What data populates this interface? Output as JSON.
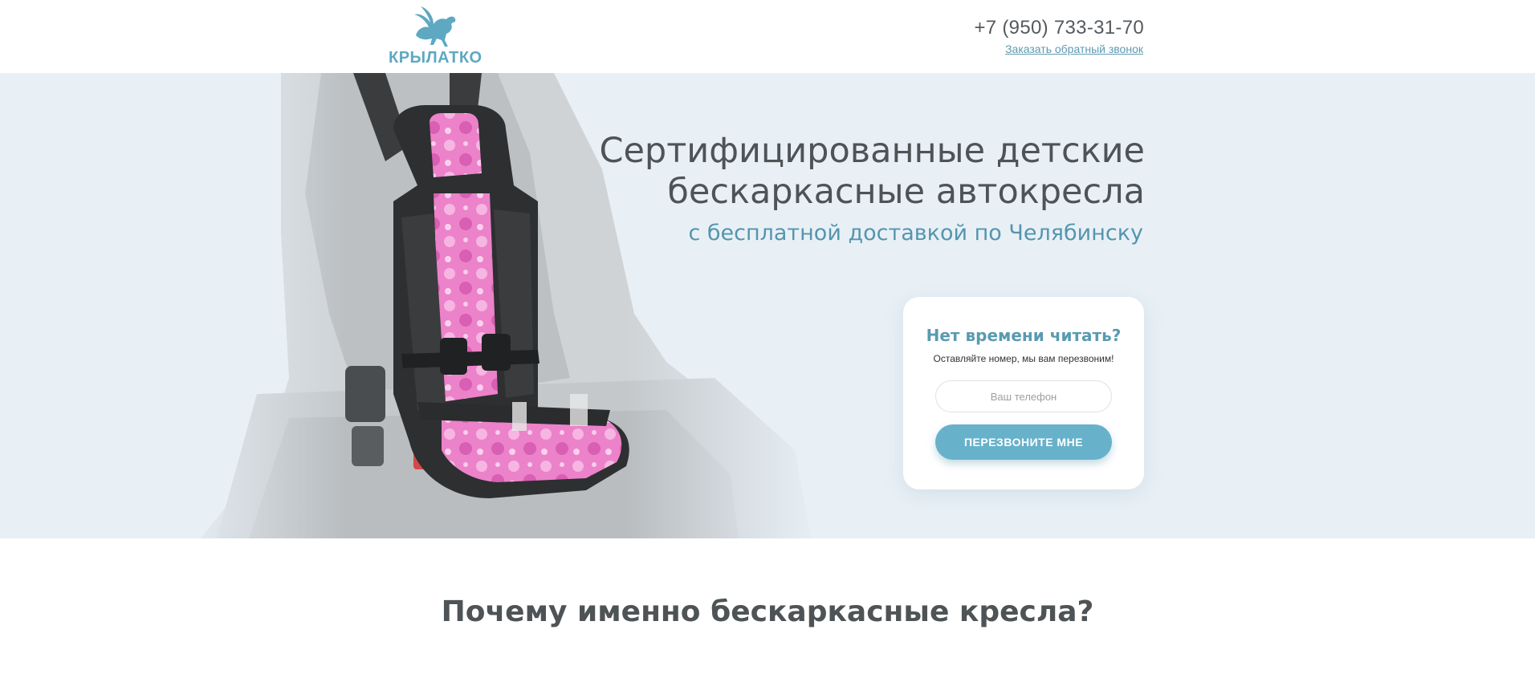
{
  "header": {
    "logo_text": "КРЫЛАТКО",
    "phone": "+7 (950) 733-31-70",
    "callback_link": "Заказать обратный звонок"
  },
  "hero": {
    "title": "Сертифицированные детские бескаркасные автокресла",
    "subtitle": "с бесплатной доставкой по Челябинску",
    "form": {
      "title": "Нет времени читать?",
      "description": "Оставляйте номер, мы вам перезвоним!",
      "phone_placeholder": "Ваш телефон",
      "submit_label": "ПЕРЕЗВОНИТЕ МНЕ"
    }
  },
  "why": {
    "title": "Почему именно бескаркасные кресла?"
  },
  "colors": {
    "accent": "#67b1cb",
    "accent_text": "#5595ad",
    "hero_bg": "#e8f0f6",
    "heading": "#4e5356",
    "seat_pink": "#e97bc6",
    "seat_dark": "#2d2f31"
  },
  "icons": {
    "logo": "winged-horse-icon"
  }
}
